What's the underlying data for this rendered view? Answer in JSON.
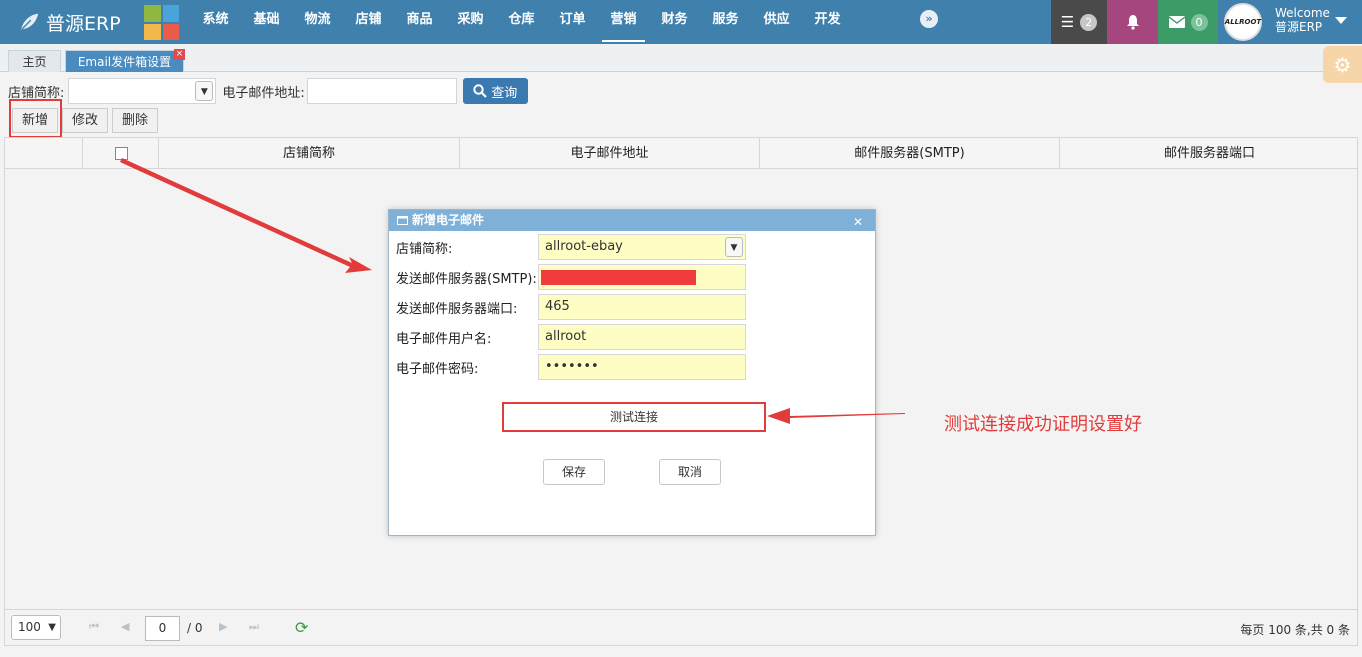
{
  "app": {
    "name": "普源ERP",
    "brand_color": "#3f80ad"
  },
  "nav": [
    "系统",
    "基础",
    "物流",
    "店铺",
    "商品",
    "采购",
    "仓库",
    "订单",
    "营销",
    "财务",
    "服务",
    "供应",
    "开发"
  ],
  "nav_active": "营销",
  "topbar": {
    "tasks_count": "2",
    "mail_count": "0",
    "welcome": "Welcome",
    "user_name": "普源ERP",
    "avatar_text": "ALLROOT"
  },
  "tabs": {
    "home": "主页",
    "current": "Email发件箱设置"
  },
  "search": {
    "shop_label": "店铺简称:",
    "email_label": "电子邮件地址:",
    "query_button": "查询"
  },
  "toolbar": {
    "add": "新增",
    "edit": "修改",
    "delete": "删除"
  },
  "table": {
    "columns": [
      "店铺简称",
      "电子邮件地址",
      "邮件服务器(SMTP)",
      "邮件服务器端口"
    ]
  },
  "pager": {
    "page_size": "100",
    "page": "0",
    "total_pages": "/ 0",
    "info": "每页 100 条,共 0 条"
  },
  "dialog": {
    "title": "新增电子邮件",
    "fields": [
      {
        "label": "店铺简称:",
        "value": "allroot-ebay"
      },
      {
        "label": "发送邮件服务器(SMTP):",
        "value": ""
      },
      {
        "label": "发送邮件服务器端口:",
        "value": "465"
      },
      {
        "label": "电子邮件用户名:",
        "value": "allroot"
      },
      {
        "label": "电子邮件密码:",
        "value": "•••••••"
      }
    ],
    "test_button": "测试连接",
    "save_button": "保存",
    "cancel_button": "取消"
  },
  "annotation": {
    "note": "测试连接成功证明设置好",
    "color": "#e23b3b"
  }
}
